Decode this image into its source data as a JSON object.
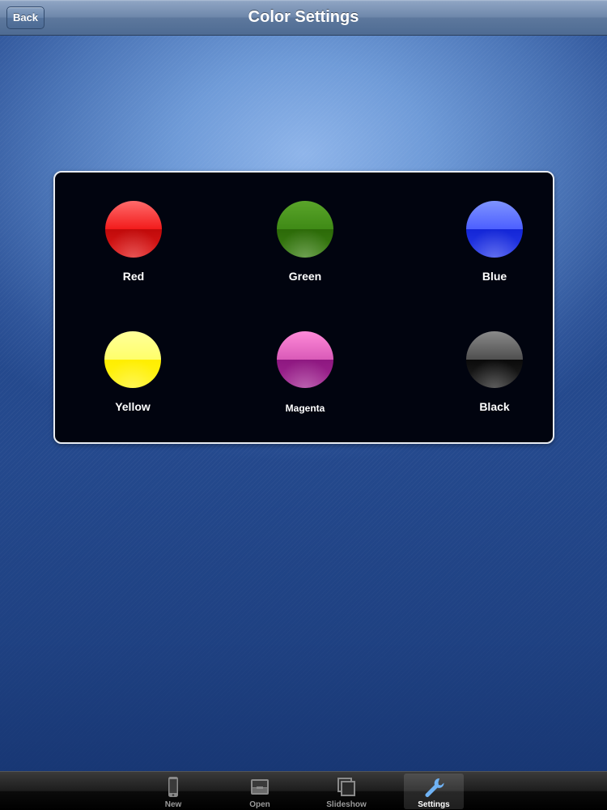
{
  "navbar": {
    "title": "Color Settings",
    "back_label": "Back"
  },
  "colors": [
    {
      "label": "Red",
      "hex": "#e81414"
    },
    {
      "label": "Green",
      "hex": "#3a7d12"
    },
    {
      "label": "Blue",
      "hex": "#2b3dea"
    },
    {
      "label": "Yellow",
      "hex": "#fff41a"
    },
    {
      "label": "Magenta",
      "hex": "#b33aa0"
    },
    {
      "label": "Black",
      "hex": "#1a1a1a"
    }
  ],
  "tabs": [
    {
      "label": "New",
      "icon": "phone-icon",
      "selected": false
    },
    {
      "label": "Open",
      "icon": "inbox-tray-icon",
      "selected": false
    },
    {
      "label": "Slideshow",
      "icon": "stacked-frames-icon",
      "selected": false
    },
    {
      "label": "Settings",
      "icon": "wrench-icon",
      "selected": true
    }
  ]
}
